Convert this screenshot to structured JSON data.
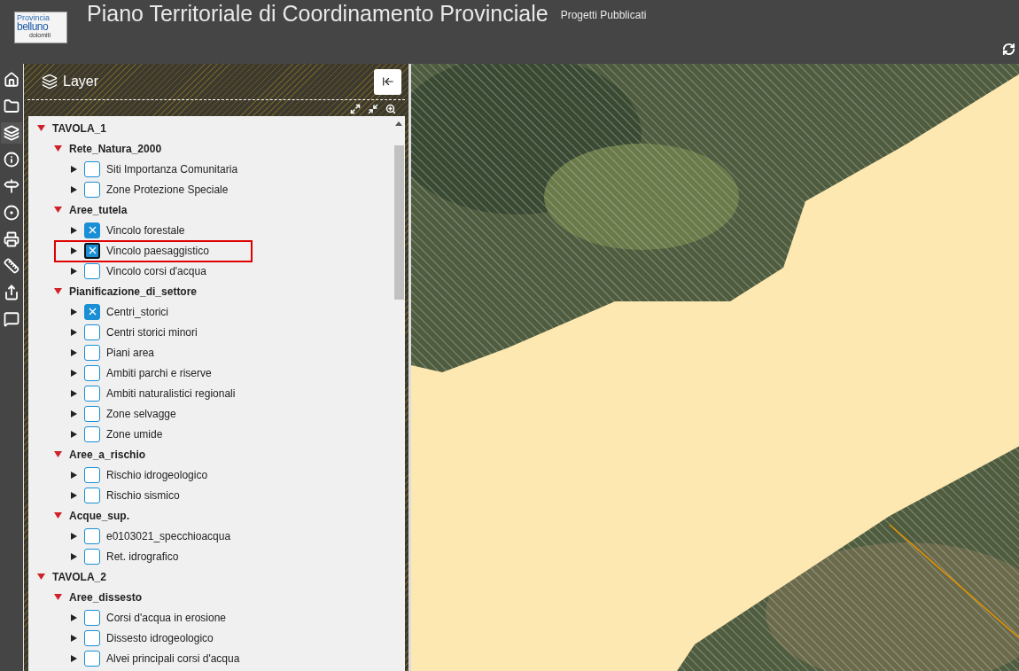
{
  "header": {
    "logo": {
      "line_1": "Provincia",
      "line_2": "belluno",
      "line_3": "dolomiti"
    },
    "title": "Piano Territoriale di Coordinamento Provinciale",
    "subtitle": "Progetti Pubblicati"
  },
  "toolbar": [
    {
      "kind": "home",
      "selected": false
    },
    {
      "kind": "folder",
      "selected": false
    },
    {
      "kind": "layers",
      "selected": true
    },
    {
      "kind": "info",
      "selected": false
    },
    {
      "kind": "signpost",
      "selected": false
    },
    {
      "kind": "target",
      "selected": false
    },
    {
      "kind": "print",
      "selected": false
    },
    {
      "kind": "measure",
      "selected": false
    },
    {
      "kind": "share",
      "selected": false
    },
    {
      "kind": "comment",
      "selected": false
    }
  ],
  "panel": {
    "title": "Layer",
    "tree": [
      {
        "label": "TAVOLA_1",
        "expanded": true,
        "children": [
          {
            "label": "Rete_Natura_2000",
            "expanded": true,
            "children": [
              {
                "label": "Siti Importanza Comunitaria",
                "checked": false,
                "highlighted": false
              },
              {
                "label": "Zone Protezione Speciale",
                "checked": false,
                "highlighted": false
              }
            ]
          },
          {
            "label": "Aree_tutela",
            "expanded": true,
            "children": [
              {
                "label": "Vincolo forestale",
                "checked": true,
                "highlighted": false
              },
              {
                "label": "Vincolo paesaggistico",
                "checked": true,
                "highlighted": true
              },
              {
                "label": "Vincolo corsi d'acqua",
                "checked": false,
                "highlighted": false
              }
            ]
          },
          {
            "label": "Pianificazione_di_settore",
            "expanded": true,
            "children": [
              {
                "label": "Centri_storici",
                "checked": true,
                "highlighted": false
              },
              {
                "label": "Centri storici minori",
                "checked": false,
                "highlighted": false
              },
              {
                "label": "Piani area",
                "checked": false,
                "highlighted": false
              },
              {
                "label": "Ambiti parchi e riserve",
                "checked": false,
                "highlighted": false
              },
              {
                "label": "Ambiti naturalistici regionali",
                "checked": false,
                "highlighted": false
              },
              {
                "label": "Zone selvagge",
                "checked": false,
                "highlighted": false
              },
              {
                "label": "Zone umide",
                "checked": false,
                "highlighted": false
              }
            ]
          },
          {
            "label": "Aree_a_rischio",
            "expanded": true,
            "children": [
              {
                "label": "Rischio idrogeologico",
                "checked": false,
                "highlighted": false
              },
              {
                "label": "Rischio sismico",
                "checked": false,
                "highlighted": false
              }
            ]
          },
          {
            "label": "Acque_sup.",
            "expanded": true,
            "children": [
              {
                "label": "e0103021_specchioacqua",
                "checked": false,
                "highlighted": false
              },
              {
                "label": "Ret. idrografico",
                "checked": false,
                "highlighted": false
              }
            ]
          }
        ]
      },
      {
        "label": "TAVOLA_2",
        "expanded": true,
        "children": [
          {
            "label": "Aree_dissesto",
            "expanded": true,
            "children": [
              {
                "label": "Corsi d'acqua in erosione",
                "checked": false,
                "highlighted": false
              },
              {
                "label": "Dissesto idrogeologico",
                "checked": false,
                "highlighted": false
              },
              {
                "label": "Alvei principali corsi d'acqua",
                "checked": false,
                "highlighted": false
              }
            ]
          }
        ]
      }
    ]
  }
}
